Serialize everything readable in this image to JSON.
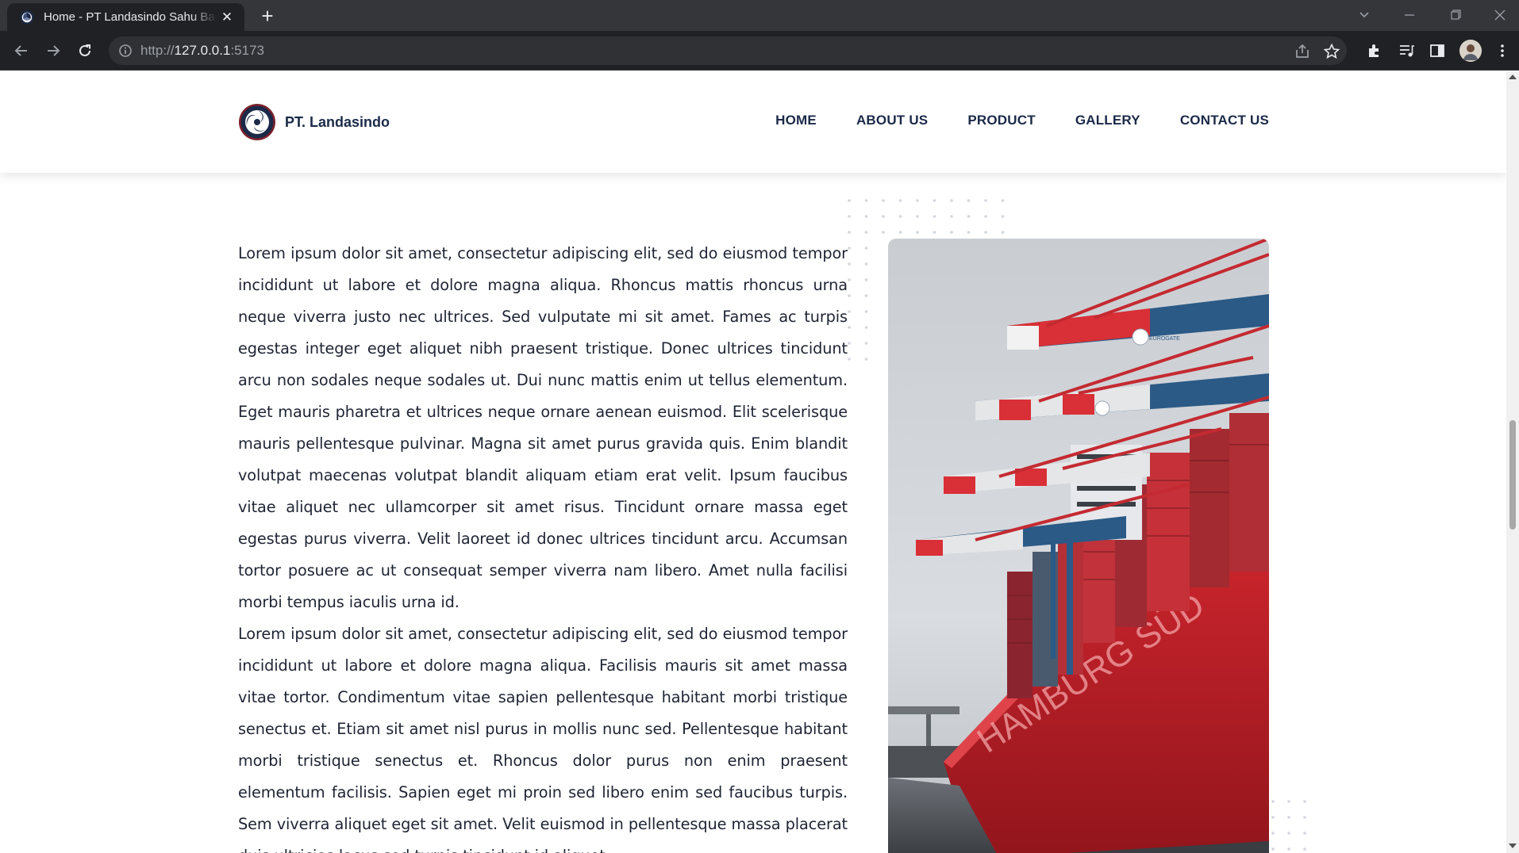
{
  "browser": {
    "tab_title": "Home - PT Landasindo Sahu Bara",
    "url_scheme": "http://",
    "url_host": "127.0.0.1",
    "url_port": ":5173",
    "new_tab_symbol": "+",
    "close_symbol": "✕"
  },
  "site": {
    "brand_name": "PT. Landasindo",
    "nav": [
      {
        "label": "HOME"
      },
      {
        "label": "ABOUT US"
      },
      {
        "label": "PRODUCT"
      },
      {
        "label": "GALLERY"
      },
      {
        "label": "CONTACT US"
      }
    ],
    "colors": {
      "brand_navy": "#1b2a48",
      "text": "#1e2433",
      "dot": "#cfd3da",
      "ship_red": "#c8262d"
    }
  },
  "content": {
    "paragraph_1": "Lorem ipsum dolor sit amet, consectetur adipiscing elit, sed do eiusmod tempor incididunt ut labore et dolore magna aliqua. Rhoncus mattis rhoncus urna neque viverra justo nec ultrices. Sed vulputate mi sit amet. Fames ac turpis egestas integer eget aliquet nibh praesent tristique. Donec ultrices tincidunt arcu non sodales neque sodales ut. Dui nunc mattis enim ut tellus elementum. Eget mauris pharetra et ultrices neque ornare aenean euismod. Elit scelerisque mauris pellentesque pulvinar. Magna sit amet purus gravida quis. Enim blandit volutpat maecenas volutpat blandit aliquam etiam erat velit. Ipsum faucibus vitae aliquet nec ullamcorper sit amet risus. Tincidunt ornare massa eget egestas purus viverra. Velit laoreet id donec ultrices tincidunt arcu. Accumsan tortor posuere ac ut consequat semper viverra nam libero. Amet nulla facilisi morbi tempus iaculis urna id.",
    "paragraph_2": "Lorem ipsum dolor sit amet, consectetur adipiscing elit, sed do eiusmod tempor incididunt ut labore et dolore magna aliqua. Facilisis mauris sit amet massa vitae tortor. Condimentum vitae sapien pellentesque habitant morbi tristique senectus et. Etiam sit amet nisl purus in mollis nunc sed. Pellentesque habitant morbi tristique senectus et. Rhoncus dolor purus non enim praesent elementum facilisis. Sapien eget mi proin sed libero enim sed faucibus turpis. Sem viverra aliquet eget sit amet. Velit euismod in pellentesque massa placerat duis ultricies lacus sed turpis tincidunt id aliquet."
  },
  "image": {
    "ship_hull_text": "HAMBURG SÜD",
    "crane_logo_text": "EUROGATE"
  },
  "icons": [
    "site-favicon-icon",
    "back-arrow-icon",
    "forward-arrow-icon",
    "reload-icon",
    "info-icon",
    "share-icon",
    "star-icon",
    "extensions-icon",
    "media-icon",
    "side-panel-icon",
    "profile-avatar",
    "more-menu-icon",
    "tab-search-icon",
    "minimize-icon",
    "maximize-icon",
    "window-close-icon"
  ]
}
